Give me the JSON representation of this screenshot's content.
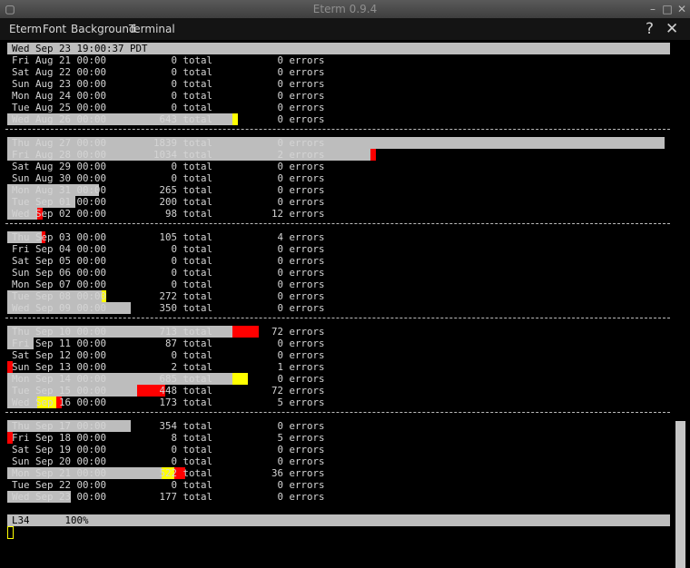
{
  "window": {
    "title": "Eterm 0.9.4",
    "menus": [
      "Eterm",
      "Font",
      "Background",
      "Terminal"
    ],
    "help_glyph": "?",
    "close_glyph": "✕"
  },
  "header_line": "Wed Sep 23 19:00:37 PDT",
  "rows": [
    {
      "date": "Fri Aug 21 00:00",
      "total": "0",
      "errors": "0",
      "bars": []
    },
    {
      "date": "Sat Aug 22 00:00",
      "total": "0",
      "errors": "0",
      "bars": []
    },
    {
      "date": "Sun Aug 23 00:00",
      "total": "0",
      "errors": "0",
      "bars": []
    },
    {
      "date": "Mon Aug 24 00:00",
      "total": "0",
      "errors": "0",
      "bars": []
    },
    {
      "date": "Tue Aug 25 00:00",
      "total": "0",
      "errors": "0",
      "bars": []
    },
    {
      "date": "Wed Aug 26 00:00",
      "total": "643",
      "errors": "0",
      "bars": [
        {
          "c": "gray",
          "from": 0,
          "to": 0.342
        },
        {
          "c": "yellow",
          "from": 0.342,
          "to": 0.35
        }
      ]
    },
    {
      "date": "Thu Aug 27 00:00",
      "total": "1839",
      "errors": "0",
      "bars": [
        {
          "c": "gray",
          "from": 0,
          "to": 1.0
        }
      ]
    },
    {
      "date": "Fri Aug 28 00:00",
      "total": "1034",
      "errors": "2",
      "bars": [
        {
          "c": "gray",
          "from": 0,
          "to": 0.552
        },
        {
          "c": "red",
          "from": 0.552,
          "to": 0.56
        }
      ]
    },
    {
      "date": "Sat Aug 29 00:00",
      "total": "0",
      "errors": "0",
      "bars": []
    },
    {
      "date": "Sun Aug 30 00:00",
      "total": "0",
      "errors": "0",
      "bars": []
    },
    {
      "date": "Mon Aug 31 00:00",
      "total": "265",
      "errors": "0",
      "bars": [
        {
          "c": "gray",
          "from": 0,
          "to": 0.139
        }
      ]
    },
    {
      "date": "Tue Sep 01 00:00",
      "total": "200",
      "errors": "0",
      "bars": [
        {
          "c": "gray",
          "from": 0,
          "to": 0.104
        }
      ]
    },
    {
      "date": "Wed Sep 02 00:00",
      "total": "98",
      "errors": "12",
      "bars": [
        {
          "c": "gray",
          "from": 0,
          "to": 0.045
        },
        {
          "c": "red",
          "from": 0.045,
          "to": 0.053
        }
      ]
    },
    {
      "date": "Thu Sep 03 00:00",
      "total": "105",
      "errors": "4",
      "bars": [
        {
          "c": "gray",
          "from": 0,
          "to": 0.052
        },
        {
          "c": "red",
          "from": 0.052,
          "to": 0.058
        }
      ]
    },
    {
      "date": "Fri Sep 04 00:00",
      "total": "0",
      "errors": "0",
      "bars": []
    },
    {
      "date": "Sat Sep 05 00:00",
      "total": "0",
      "errors": "0",
      "bars": []
    },
    {
      "date": "Sun Sep 06 00:00",
      "total": "0",
      "errors": "0",
      "bars": []
    },
    {
      "date": "Mon Sep 07 00:00",
      "total": "0",
      "errors": "0",
      "bars": []
    },
    {
      "date": "Tue Sep 08 00:00",
      "total": "272",
      "errors": "0",
      "bars": [
        {
          "c": "gray",
          "from": 0,
          "to": 0.143
        },
        {
          "c": "yellow",
          "from": 0.143,
          "to": 0.15
        }
      ]
    },
    {
      "date": "Wed Sep 09 00:00",
      "total": "350",
      "errors": "0",
      "bars": [
        {
          "c": "gray",
          "from": 0,
          "to": 0.188
        }
      ]
    },
    {
      "date": "Thu Sep 10 00:00",
      "total": "713",
      "errors": "72",
      "bars": [
        {
          "c": "gray",
          "from": 0,
          "to": 0.342
        },
        {
          "c": "red",
          "from": 0.342,
          "to": 0.382
        }
      ]
    },
    {
      "date": "Fri Sep 11 00:00",
      "total": "87",
      "errors": "0",
      "bars": [
        {
          "c": "gray",
          "from": 0,
          "to": 0.04
        }
      ]
    },
    {
      "date": "Sat Sep 12 00:00",
      "total": "0",
      "errors": "0",
      "bars": []
    },
    {
      "date": "Sun Sep 13 00:00",
      "total": "2",
      "errors": "1",
      "bars": [
        {
          "c": "red",
          "from": 0,
          "to": 0.008
        }
      ]
    },
    {
      "date": "Mon Sep 14 00:00",
      "total": "685",
      "errors": "0",
      "bars": [
        {
          "c": "gray",
          "from": 0,
          "to": 0.342
        },
        {
          "c": "yellow",
          "from": 0.342,
          "to": 0.365
        }
      ]
    },
    {
      "date": "Tue Sep 15 00:00",
      "total": "448",
      "errors": "72",
      "bars": [
        {
          "c": "gray",
          "from": 0,
          "to": 0.197
        },
        {
          "c": "red",
          "from": 0.197,
          "to": 0.24
        }
      ]
    },
    {
      "date": "Wed Sep 16 00:00",
      "total": "173",
      "errors": "5",
      "bars": [
        {
          "c": "gray",
          "from": 0,
          "to": 0.045
        },
        {
          "c": "yellow",
          "from": 0.045,
          "to": 0.075
        },
        {
          "c": "red",
          "from": 0.075,
          "to": 0.083
        }
      ]
    },
    {
      "date": "Thu Sep 17 00:00",
      "total": "354",
      "errors": "0",
      "bars": [
        {
          "c": "gray",
          "from": 0,
          "to": 0.188
        }
      ]
    },
    {
      "date": "Fri Sep 18 00:00",
      "total": "8",
      "errors": "5",
      "bars": [
        {
          "c": "red",
          "from": 0,
          "to": 0.008
        }
      ]
    },
    {
      "date": "Sat Sep 19 00:00",
      "total": "0",
      "errors": "0",
      "bars": []
    },
    {
      "date": "Sun Sep 20 00:00",
      "total": "0",
      "errors": "0",
      "bars": []
    },
    {
      "date": "Mon Sep 21 00:00",
      "total": "522",
      "errors": "36",
      "bars": [
        {
          "c": "gray",
          "from": 0,
          "to": 0.235
        },
        {
          "c": "yellow",
          "from": 0.235,
          "to": 0.254
        },
        {
          "c": "red",
          "from": 0.254,
          "to": 0.27
        }
      ]
    },
    {
      "date": "Tue Sep 22 00:00",
      "total": "0",
      "errors": "0",
      "bars": []
    },
    {
      "date": "Wed Sep 23 00:00",
      "total": "177",
      "errors": "0",
      "bars": [
        {
          "c": "gray",
          "from": 0,
          "to": 0.097
        }
      ]
    }
  ],
  "labels": {
    "total": "total",
    "errors": "errors"
  },
  "status_line": "L34      100%",
  "colors": {
    "gray": "#bdbdbd",
    "yellow": "#ffff00",
    "red": "#ff0000",
    "text": "#d4d4d4",
    "background": "#000000"
  }
}
